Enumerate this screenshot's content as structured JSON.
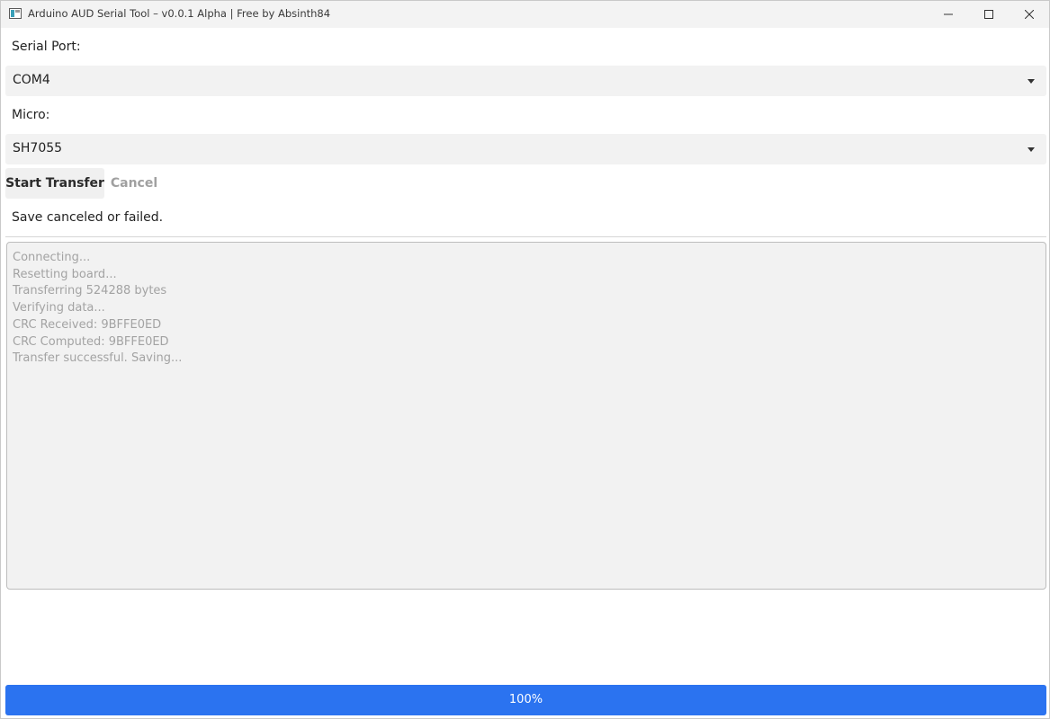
{
  "window": {
    "title": "Arduino AUD Serial Tool – v0.0.1 Alpha | Free by Absinth84",
    "icon": "app-window-icon",
    "controls": [
      "minimize-icon",
      "maximize-icon",
      "close-icon"
    ]
  },
  "serial_port": {
    "label": "Serial Port:",
    "selected": "COM4"
  },
  "micro": {
    "label": "Micro:",
    "selected": "SH7055"
  },
  "actions": {
    "start_label": "Start Transfer",
    "cancel_label": "Cancel"
  },
  "status": {
    "text": "Save canceled or failed."
  },
  "log": {
    "lines": [
      "Connecting...",
      "Resetting board...",
      "Transferring 524288 bytes",
      "Verifying data...",
      "CRC Received: 9BFFE0ED",
      "CRC Computed: 9BFFE0ED",
      "Transfer successful. Saving..."
    ]
  },
  "progress": {
    "value": 1.0,
    "label": "100%"
  },
  "colors": {
    "accent": "#2b73f0",
    "titlebar": "#f3f3f3",
    "field_bg": "#f2f2f2",
    "log_text": "#a3a3a3"
  }
}
